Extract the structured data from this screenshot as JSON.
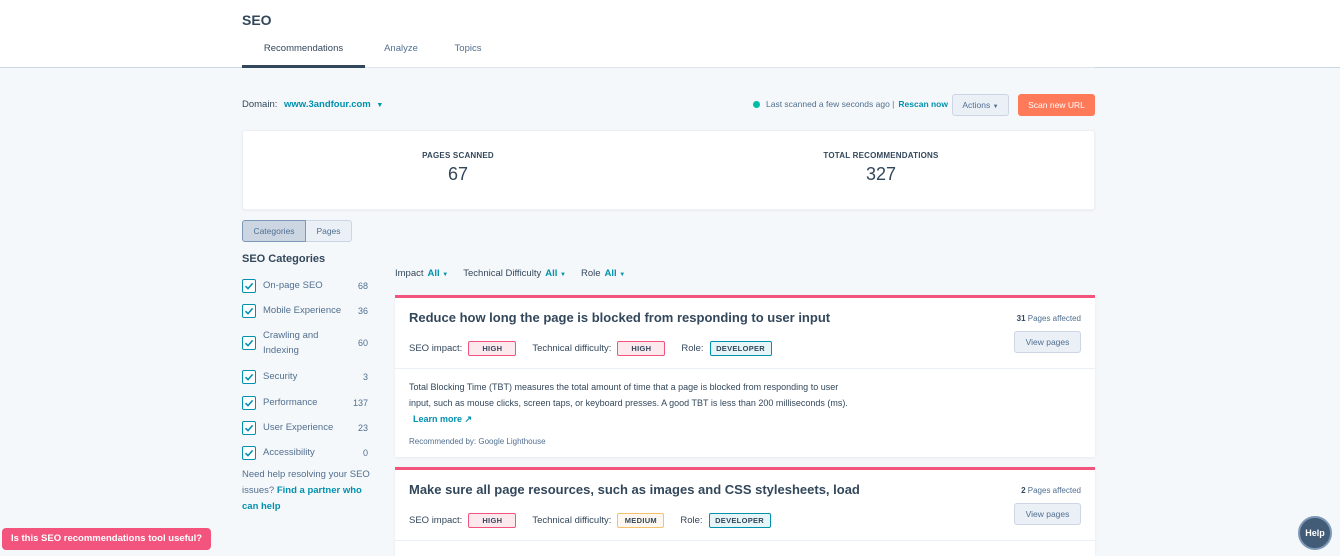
{
  "header": {
    "title": "SEO",
    "tabs": [
      {
        "label": "Recommendations"
      },
      {
        "label": "Analyze"
      },
      {
        "label": "Topics"
      }
    ]
  },
  "domain": {
    "label": "Domain:",
    "value": "www.3andfour.com"
  },
  "scan": {
    "status": "Last scanned a few seconds ago |",
    "rescan": "Rescan now",
    "actions": "Actions",
    "scan_new": "Scan new URL"
  },
  "stats": {
    "pages_label": "PAGES SCANNED",
    "pages_value": "67",
    "recs_label": "TOTAL RECOMMENDATIONS",
    "recs_value": "327"
  },
  "view_toggle": {
    "categories": "Categories",
    "pages": "Pages"
  },
  "sidebar": {
    "title": "SEO Categories",
    "categories": [
      {
        "label": "On-page SEO",
        "count": "68"
      },
      {
        "label": "Mobile Experience",
        "count": "36"
      },
      {
        "label": "Crawling and Indexing",
        "count": "60"
      },
      {
        "label": "Security",
        "count": "3"
      },
      {
        "label": "Performance",
        "count": "137"
      },
      {
        "label": "User Experience",
        "count": "23"
      },
      {
        "label": "Accessibility",
        "count": "0"
      }
    ],
    "help_text": "Need help resolving your SEO issues?",
    "help_link": "Find a partner who can help"
  },
  "filters": [
    {
      "label": "Impact",
      "value": "All"
    },
    {
      "label": "Technical Difficulty",
      "value": "All"
    },
    {
      "label": "Role",
      "value": "All"
    }
  ],
  "recommendations": [
    {
      "title": "Reduce how long the page is blocked from responding to user input",
      "affected_count": "31",
      "affected_label": "Pages affected",
      "impact_label": "SEO impact:",
      "impact": "HIGH",
      "difficulty_label": "Technical difficulty:",
      "difficulty": "HIGH",
      "role_label": "Role:",
      "role": "DEVELOPER",
      "view_pages": "View pages",
      "description": "Total Blocking Time (TBT) measures the total amount of time that a page is blocked from responding to user input, such as mouse clicks, screen taps, or keyboard presses. A good TBT is less than 200 milliseconds (ms).",
      "learn_more": "Learn more",
      "recommended_by": "Recommended by: Google Lighthouse"
    },
    {
      "title": "Make sure all page resources, such as images and CSS stylesheets, load",
      "affected_count": "2",
      "affected_label": "Pages affected",
      "impact_label": "SEO impact:",
      "impact": "HIGH",
      "difficulty_label": "Technical difficulty:",
      "difficulty": "MEDIUM",
      "role_label": "Role:",
      "role": "DEVELOPER",
      "view_pages": "View pages"
    }
  ],
  "feedback": "Is this SEO recommendations tool useful?",
  "help": "Help",
  "colors": {
    "accent": "#0091ae",
    "primary_button": "#ff7a59",
    "card_border": "#f2547d",
    "text": "#33475b"
  }
}
